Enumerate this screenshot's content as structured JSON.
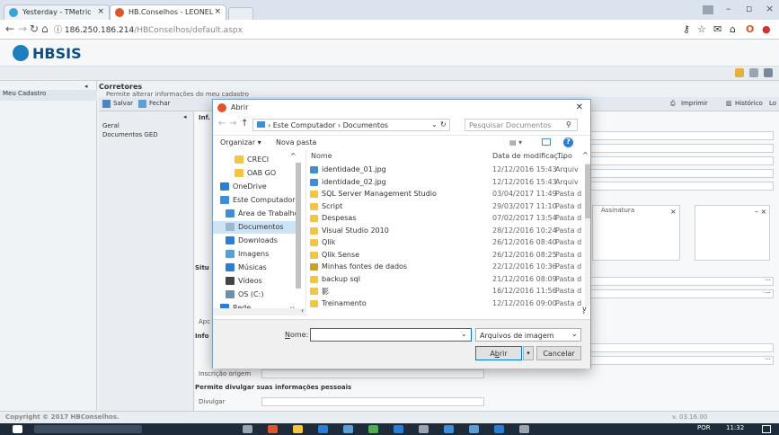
{
  "browser": {
    "tabs": [
      {
        "label": "Yesterday - TMetric"
      },
      {
        "label": "HB.Conselhos - LEONEL"
      }
    ],
    "url_host": "186.250.186.214",
    "url_path": "/HBConselhos/default.aspx",
    "info_glyph": "ⓘ"
  },
  "app": {
    "logo_text": "HBSIS",
    "left_panel_title": "Meu Cadastro",
    "section_title": "Corretores",
    "section_subtitle": "Permite alterar informações do meu cadastro",
    "toolbar": {
      "save": "Salvar",
      "close": "Fechar",
      "print": "Imprimir",
      "history": "Histórico",
      "log": "Lo"
    },
    "subnav": [
      "Geral",
      "Documentos GED"
    ],
    "content_tab": "Inf.",
    "labels": {
      "sit": "Situ",
      "apc": "Apc",
      "info": "Info",
      "inscricao": "Inscrição origem",
      "permite": "Permite divulgar suas informações pessoais",
      "divulgar": "Divulgar",
      "assinatura": "Assinatura"
    },
    "footer_left": "Copyright © 2017 HBConselhos.",
    "footer_right": "v. 03.16.00"
  },
  "taskbar": {
    "lang": "POR",
    "time": "11:32"
  },
  "dialog": {
    "title": "Abrir",
    "breadcrumb": [
      "Este Computador",
      "Documentos"
    ],
    "search_placeholder": "Pesquisar Documentos",
    "organize": "Organizar ▾",
    "new_folder": "Nova pasta",
    "nav_items": [
      {
        "label": "CRECI",
        "icon": "folder-icon",
        "color": "#f5c542"
      },
      {
        "label": "OAB GO",
        "icon": "folder-icon",
        "color": "#f5c542"
      },
      {
        "label": "OneDrive",
        "icon": "cloud-icon",
        "color": "#2a7fd4"
      },
      {
        "label": "Este Computador",
        "icon": "computer-icon",
        "color": "#3c8fd8"
      },
      {
        "label": "Área de Trabalho",
        "icon": "desktop-icon",
        "color": "#3c8fd8"
      },
      {
        "label": "Documentos",
        "icon": "documents-icon",
        "color": "#9fb6cc"
      },
      {
        "label": "Downloads",
        "icon": "download-icon",
        "color": "#2a7fd4"
      },
      {
        "label": "Imagens",
        "icon": "pictures-icon",
        "color": "#5aa0d8"
      },
      {
        "label": "Músicas",
        "icon": "music-icon",
        "color": "#2a7fd4"
      },
      {
        "label": "Vídeos",
        "icon": "videos-icon",
        "color": "#444444"
      },
      {
        "label": "OS (C:)",
        "icon": "drive-icon",
        "color": "#6d8fa8"
      },
      {
        "label": "Rede",
        "icon": "network-icon",
        "color": "#2a7fd4"
      }
    ],
    "columns": {
      "name": "Nome",
      "date": "Data de modificaç...",
      "type": "Tipo"
    },
    "files": [
      {
        "name": "identidade_01.jpg",
        "date": "12/12/2016 15:43",
        "type": "Arquiv",
        "icon": "image-file-icon"
      },
      {
        "name": "identidade_02.jpg",
        "date": "12/12/2016 15:43",
        "type": "Arquiv",
        "icon": "image-file-icon"
      },
      {
        "name": "SQL Server Management Studio",
        "date": "03/04/2017 11:49",
        "type": "Pasta d",
        "icon": "folder-icon"
      },
      {
        "name": "Script",
        "date": "29/03/2017 11:10",
        "type": "Pasta d",
        "icon": "folder-icon"
      },
      {
        "name": "Despesas",
        "date": "07/02/2017 13:54",
        "type": "Pasta d",
        "icon": "folder-icon"
      },
      {
        "name": "Visual Studio 2010",
        "date": "28/12/2016 10:24",
        "type": "Pasta d",
        "icon": "folder-icon"
      },
      {
        "name": "Qlik",
        "date": "26/12/2016 08:40",
        "type": "Pasta d",
        "icon": "folder-icon"
      },
      {
        "name": "Qlik Sense",
        "date": "26/12/2016 08:25",
        "type": "Pasta d",
        "icon": "folder-icon"
      },
      {
        "name": "Minhas fontes de dados",
        "date": "22/12/2016 10:36",
        "type": "Pasta d",
        "icon": "datasource-folder-icon"
      },
      {
        "name": "backup sql",
        "date": "21/12/2016 08:09",
        "type": "Pasta d",
        "icon": "folder-icon"
      },
      {
        "name": "影",
        "date": "16/12/2016 11:56",
        "type": "Pasta d",
        "icon": "folder-icon"
      },
      {
        "name": "Treinamento",
        "date": "12/12/2016 09:00",
        "type": "Pasta d",
        "icon": "folder-icon"
      }
    ],
    "filename_label_prefix": "N",
    "filename_label_rest": "ome:",
    "filename_value": "",
    "filter": "Arquivos de imagem",
    "open_button_prefix": "A",
    "open_button_underlined": "b",
    "open_button_rest": "rir",
    "cancel_button": "Cancelar"
  }
}
